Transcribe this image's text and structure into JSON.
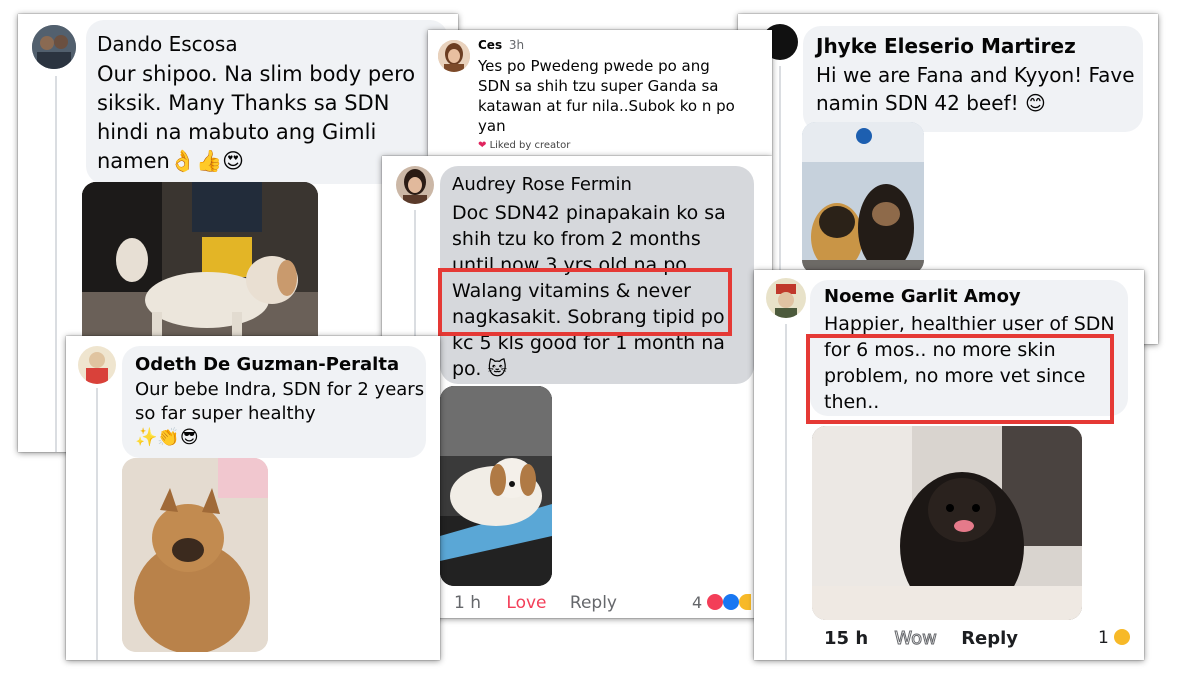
{
  "comments": {
    "dando": {
      "name": "Dando Escosa",
      "line1": "Our shipoo. Na slim body pero",
      "line2": "siksik. Many Thanks sa SDN",
      "line3": "hindi na mabuto ang Gimli",
      "line4": "namen👌👍😍"
    },
    "ces": {
      "name": "Ces",
      "time": "3h",
      "line1": "Yes po Pwedeng pwede po ang",
      "line2": "SDN sa shih tzu super Ganda sa",
      "line3": "katawan at fur nila..Subok ko n po",
      "line4": "yan",
      "liked": "Liked by creator"
    },
    "jhyke": {
      "name": "Jhyke Eleserio Martirez",
      "line1": "Hi we are Fana and Kyyon! Fave",
      "line2": "namin SDN 42 beef! 😊"
    },
    "audrey": {
      "name": "Audrey Rose Fermin",
      "line1": "Doc SDN42 pinapakain ko sa",
      "line2": "shih tzu ko from 2 months",
      "line3": "until now 3 yrs old na po.",
      "line4": "Walang vitamins & never",
      "line5": "nagkasakit. Sobrang tipid po",
      "line6": "kc 5 kls good for 1 month na",
      "line7": "po. 🐱",
      "time": "1 h",
      "love": "Love",
      "reply": "Reply",
      "reactions": "4"
    },
    "odeth": {
      "name": "Odeth De Guzman-Peralta",
      "line1": "Our bebe Indra, SDN for 2 years",
      "line2": "so far super healthy",
      "line3": "✨👏😎"
    },
    "noeme": {
      "name": "Noeme Garlit Amoy",
      "line1": "Happier, healthier user of SDN",
      "line2": "for 6 mos.. no more skin",
      "line3": "problem, no more vet since",
      "line4": "then..",
      "time": "15 h",
      "wow": "Wow",
      "reply": "Reply",
      "reactions": "1"
    }
  },
  "colors": {
    "bubble": "#f0f2f5",
    "highlight": "#e53935",
    "love": "#f33e58",
    "meta": "#65676b"
  },
  "icons": [
    "heart-icon",
    "love-reaction-icon",
    "like-reaction-icon",
    "wow-reaction-icon"
  ]
}
